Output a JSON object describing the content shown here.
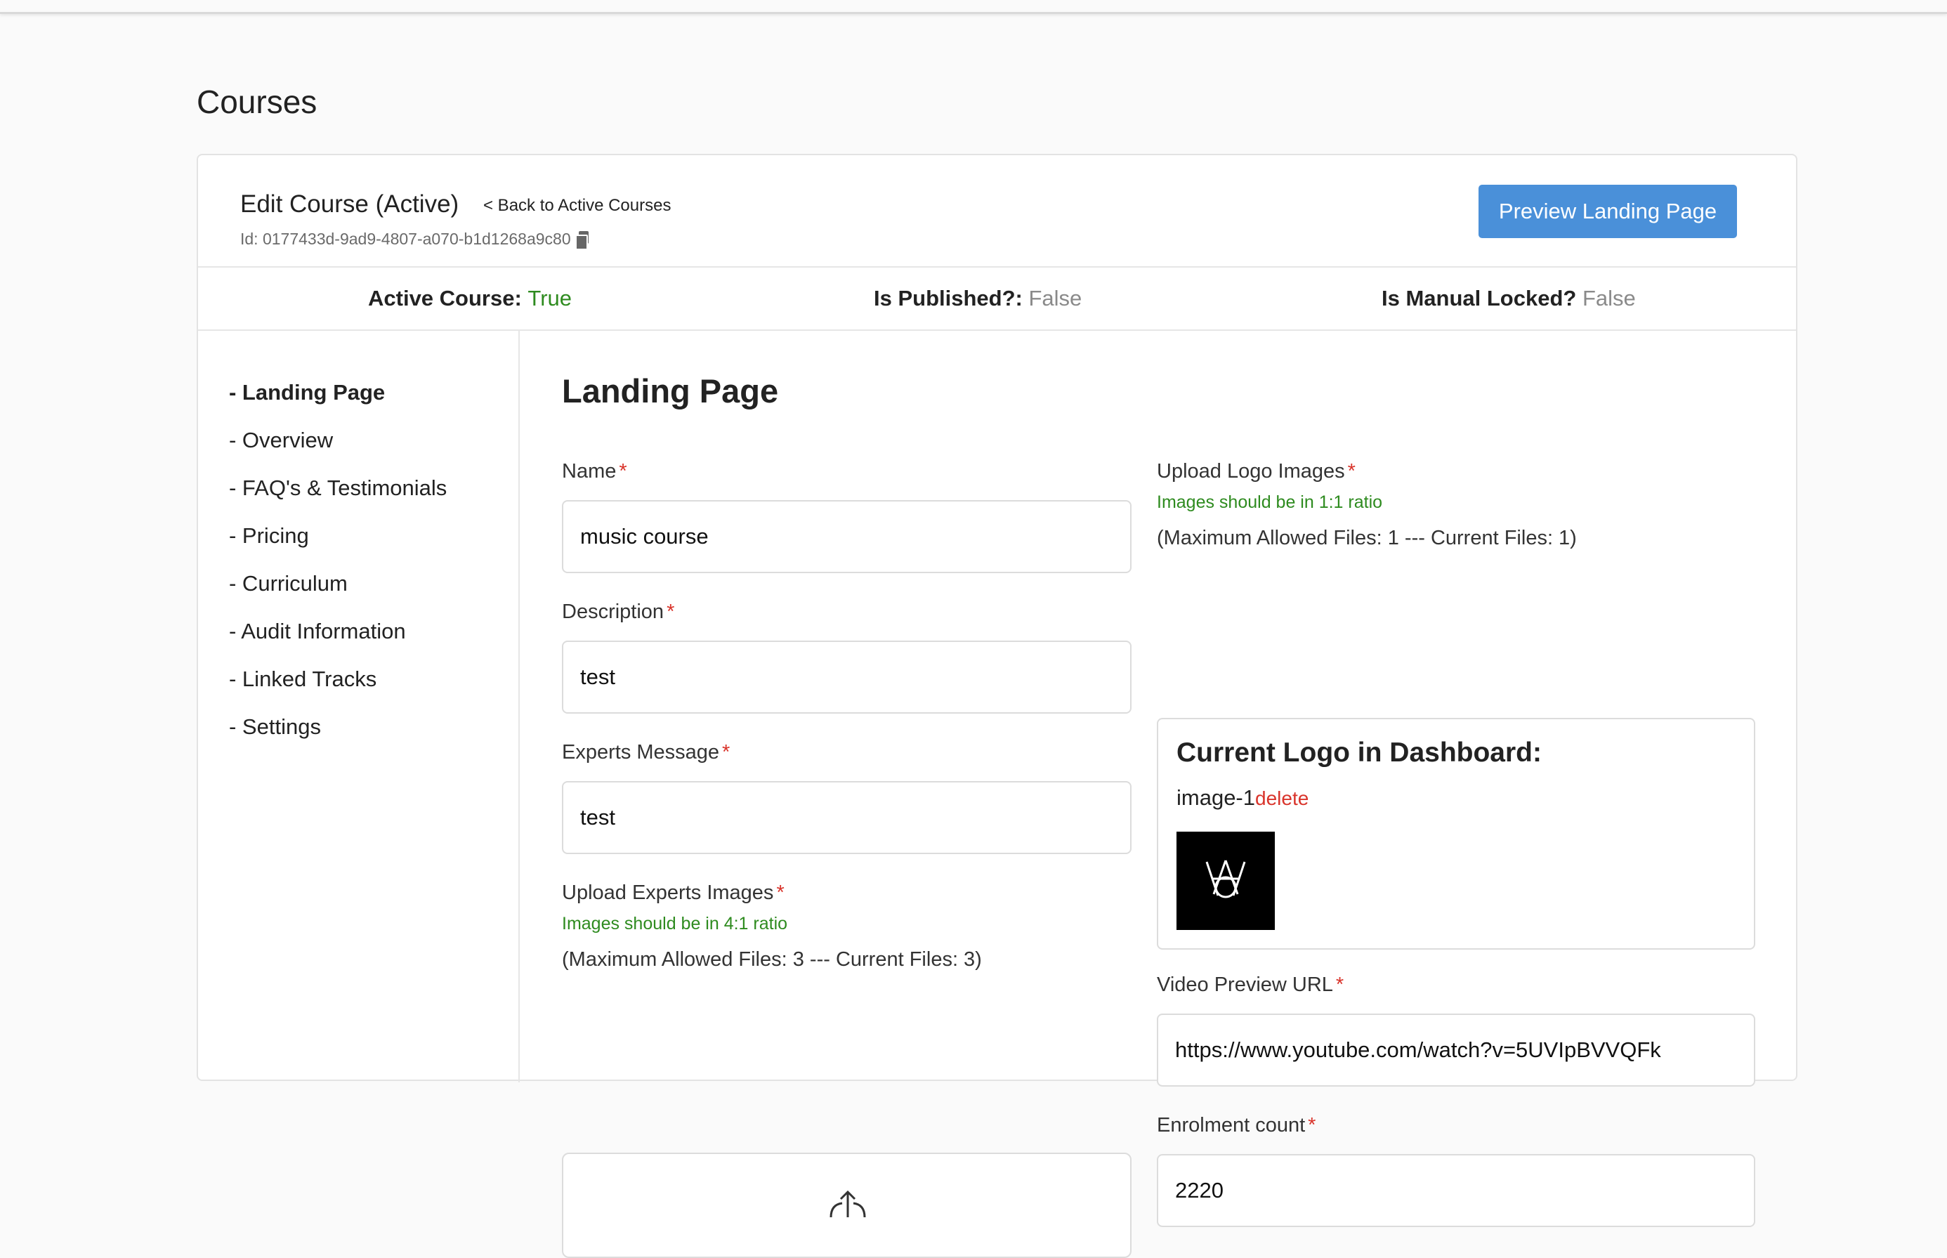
{
  "page": {
    "title": "Courses"
  },
  "header": {
    "edit_title": "Edit Course (Active)",
    "back_link": "< Back to Active Courses",
    "course_id": "Id: 0177433d-9ad9-4807-a070-b1d1268a9c80",
    "preview_button": "Preview Landing Page"
  },
  "status": {
    "active_label": "Active Course:",
    "active_value": "True",
    "published_label": "Is Published?:",
    "published_value": "False",
    "locked_label": "Is Manual Locked?",
    "locked_value": "False"
  },
  "sidebar": {
    "items": [
      {
        "label": "- Landing Page",
        "active": true
      },
      {
        "label": "- Overview"
      },
      {
        "label": "- FAQ's & Testimonials"
      },
      {
        "label": "- Pricing"
      },
      {
        "label": "- Curriculum"
      },
      {
        "label": "- Audit Information"
      },
      {
        "label": "- Linked Tracks"
      },
      {
        "label": "- Settings"
      }
    ]
  },
  "form": {
    "section_title": "Landing Page",
    "required_mark": "*",
    "name": {
      "label": "Name",
      "value": "music course"
    },
    "description": {
      "label": "Description",
      "value": "test"
    },
    "experts_message": {
      "label": "Experts Message",
      "value": "test"
    },
    "experts_images": {
      "label": "Upload Experts Images",
      "hint": "Images should be in 4:1 ratio",
      "note": "(Maximum Allowed Files: 3 --- Current Files: 3)"
    },
    "logo_images": {
      "label": "Upload Logo Images",
      "hint": "Images should be in 1:1 ratio",
      "note": "(Maximum Allowed Files: 1 --- Current Files: 1)",
      "box_title": "Current Logo in Dashboard:",
      "file_name": "image-1",
      "delete_label": "delete"
    },
    "video_url": {
      "label": "Video Preview URL",
      "value": "https://www.youtube.com/watch?v=5UVIpBVVQFk"
    },
    "enrolment": {
      "label": "Enrolment count",
      "value": "2220"
    }
  },
  "colors": {
    "primary_button": "#4a90d9",
    "success_text": "#2e8b1f",
    "muted_text": "#8a8a8a",
    "required_star": "#d9342b"
  }
}
